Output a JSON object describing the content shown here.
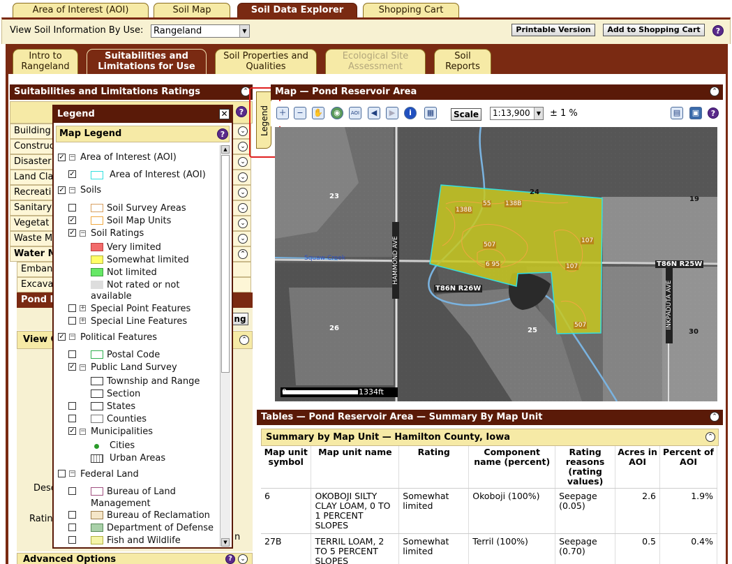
{
  "top_tabs": [
    "Area of Interest (AOI)",
    "Soil Map",
    "Soil Data Explorer",
    "Shopping Cart"
  ],
  "toolbar": {
    "view_label": "View Soil Information By Use:",
    "use_value": "Rangeland",
    "printable_label": "Printable Version",
    "cart_label": "Add to Shopping Cart"
  },
  "sub_tabs": [
    [
      "Intro to",
      "Rangeland"
    ],
    [
      "Suitabilities and",
      "Limitations for Use"
    ],
    [
      "Soil Properties and",
      "Qualities"
    ],
    [
      "Ecological Site",
      "Assessment"
    ],
    [
      "Soil",
      "Reports"
    ]
  ],
  "left_panel": {
    "title": "Suitabilities and Limitations Ratings",
    "rows": [
      "Building",
      "Construc",
      "Disaster",
      "Land Cla",
      "Recreati",
      "Sanitary",
      "Vegetat",
      "Waste M",
      "Water M"
    ],
    "subrows": [
      "Emban",
      "Excava"
    ],
    "pond_row": "Pond I",
    "btn_frag": "ng",
    "view_frag": "View C",
    "desc_frag": "Desc",
    "rating_frag": "Ratin",
    "n_frag": "n",
    "advanced": "Advanced Options"
  },
  "legend": {
    "title": "Legend",
    "subtitle": "Map Legend",
    "items": {
      "aoi_group": "Area of Interest (AOI)",
      "aoi": "Area of Interest (AOI)",
      "soils": "Soils",
      "soil_survey_areas": "Soil Survey Areas",
      "soil_map_units": "Soil Map Units",
      "soil_ratings": "Soil Ratings",
      "very_limited": "Very limited",
      "somewhat_limited": "Somewhat limited",
      "not_limited": "Not limited",
      "not_rated_1": "Not rated or not",
      "not_rated_2": "available",
      "special_point": "Special Point Features",
      "special_line": "Special Line Features",
      "political": "Political Features",
      "postal_code": "Postal Code",
      "public_land": "Public Land Survey",
      "township": "Township and Range",
      "section": "Section",
      "states": "States",
      "counties": "Counties",
      "municipalities": "Municipalities",
      "cities": "Cities",
      "urban": "Urban Areas",
      "federal": "Federal Land",
      "blm_1": "Bureau of Land",
      "blm_2": "Management",
      "reclamation": "Bureau of Reclamation",
      "defense": "Department of Defense",
      "fish": "Fish and Wildlife"
    },
    "tab_label": "Legend"
  },
  "map": {
    "title": "Map — Pond Reservoir Area",
    "scale_button": "Scale",
    "scale_value": "1:13,900",
    "accuracy": "± 1 %",
    "scalebar_left": "0",
    "scalebar_right": "1334ft",
    "labels": {
      "s23": "23",
      "s24": "24",
      "s19": "19",
      "s26": "26",
      "s25": "25",
      "s30": "30",
      "hammond": "HAMMOND AVE",
      "inkpaduta": "INKPADUTA AVE",
      "squaw": "Squaw Creek",
      "t86n26": "T86N R26W",
      "t86n25": "T86N R25W",
      "u138b1": "138B",
      "u55": "55",
      "u138b2": "138B",
      "u507a": "507",
      "u695": "6 95",
      "u107a": "107",
      "u107b": "107",
      "u507b": "507"
    }
  },
  "tables": {
    "title": "Tables — Pond Reservoir Area — Summary By Map Unit",
    "subtitle": "Summary by Map Unit — Hamilton County, Iowa",
    "headers": [
      "Map unit symbol",
      "Map unit name",
      "Rating",
      "Component name (percent)",
      "Rating reasons (rating values)",
      "Acres in AOI",
      "Percent of AOI"
    ],
    "rows": [
      [
        "6",
        "OKOBOJI SILTY CLAY LOAM, 0 TO 1 PERCENT SLOPES",
        "Somewhat limited",
        "Okoboji (100%)",
        "Seepage (0.05)",
        "2.6",
        "1.9%"
      ],
      [
        "27B",
        "TERRIL LOAM, 2 TO 5 PERCENT SLOPES",
        "Somewhat limited",
        "Terril (100%)",
        "Seepage (0.70)",
        "0.5",
        "0.4%"
      ]
    ]
  },
  "colors": {
    "brown": "#5a1a08",
    "tab": "#f6eaa6",
    "very_limited": "#f26b6b",
    "somewhat_limited": "#ffff66",
    "not_limited": "#66e866"
  }
}
